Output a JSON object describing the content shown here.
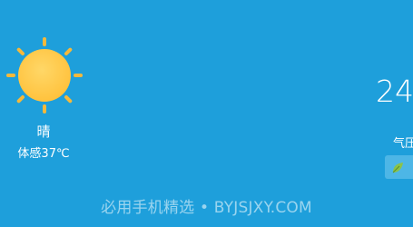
{
  "weather": {
    "condition": "晴",
    "feels_like": "体感37℃",
    "temperature": "24",
    "pressure_label": "气压",
    "sun_icon": "sun-icon",
    "aqi_icon": "leaf-icon"
  },
  "watermark": "必用手机精选 • BYJSJXY.COM",
  "colors": {
    "background": "#1e9fdb",
    "sun": "#ffc84a",
    "sun_rays": "#f5b93b",
    "aqi_badge": "#4db6e6",
    "leaf": "#8bc34a"
  }
}
